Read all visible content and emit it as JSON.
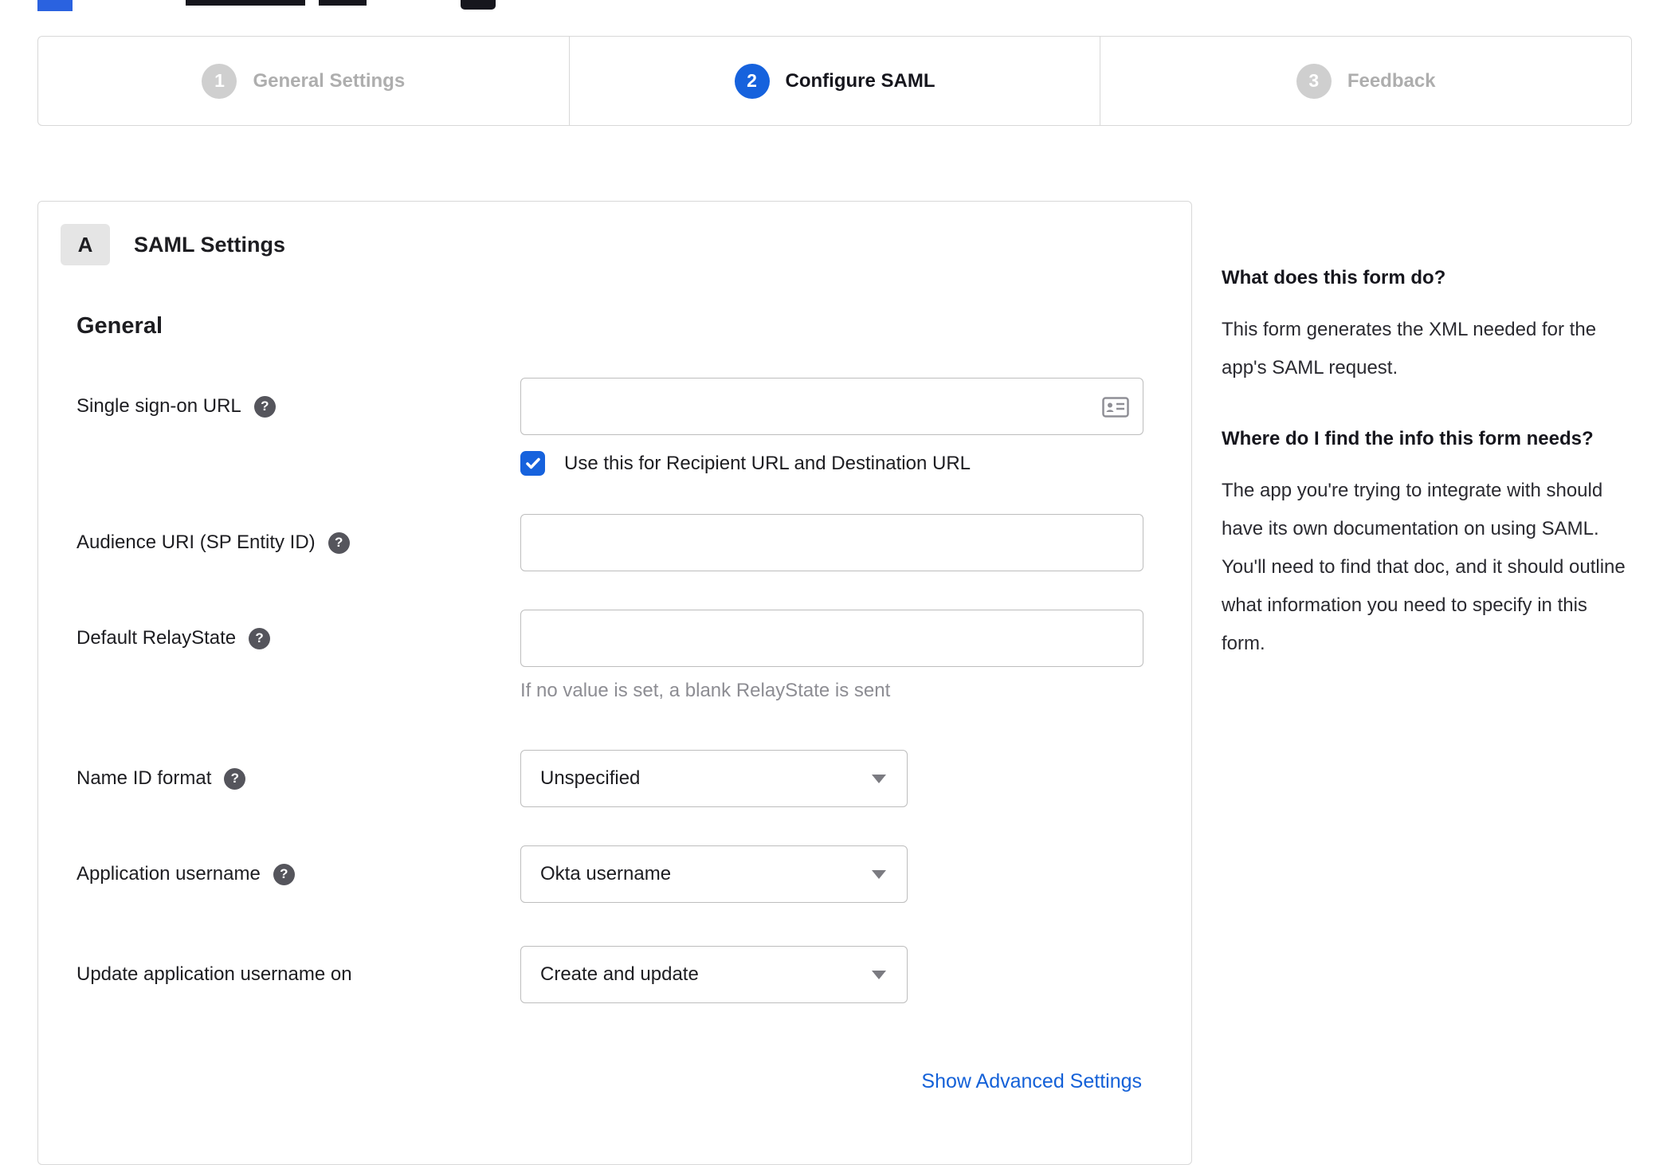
{
  "colors": {
    "accent_blue": "#1662dd",
    "link_blue": "#1461d8",
    "inactive_gray": "#aeaeae"
  },
  "stepper": {
    "steps": [
      {
        "number": "1",
        "label": "General Settings"
      },
      {
        "number": "2",
        "label": "Configure SAML"
      },
      {
        "number": "3",
        "label": "Feedback"
      }
    ]
  },
  "panel": {
    "badge": "A",
    "title": "SAML Settings",
    "section_general": "General",
    "help_icon_glyph": "?",
    "fields": {
      "sso": {
        "label": "Single sign-on URL",
        "value": "",
        "checkbox_label": "Use this for Recipient URL and Destination URL"
      },
      "audience": {
        "label": "Audience URI (SP Entity ID)",
        "value": ""
      },
      "relay": {
        "label": "Default RelayState",
        "value": "",
        "helper": "If no value is set, a blank RelayState is sent"
      },
      "name_id": {
        "label": "Name ID format",
        "value": "Unspecified"
      },
      "app_username": {
        "label": "Application username",
        "value": "Okta username"
      },
      "update_on": {
        "label": "Update application username on",
        "value": "Create and update"
      }
    },
    "advanced_link": "Show Advanced Settings"
  },
  "aside": {
    "q1": "What does this form do?",
    "a1": "This form generates the XML needed for the app's SAML request.",
    "q2": "Where do I find the info this form needs?",
    "a2": "The app you're trying to integrate with should have its own documentation on using SAML. You'll need to find that doc, and it should outline what information you need to specify in this form."
  }
}
